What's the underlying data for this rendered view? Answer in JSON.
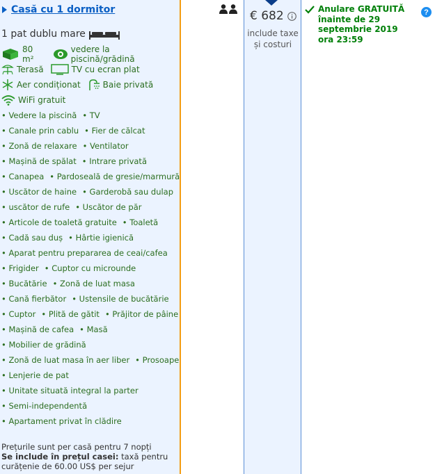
{
  "room": {
    "title": "Casă cu 1 dormitor",
    "bed": "1 pat dublu mare",
    "facilities": [
      [
        {
          "icon": "area-icon",
          "label": "80 m²"
        },
        {
          "icon": "eye-icon",
          "label": "vedere la piscină/grădină"
        }
      ],
      [
        {
          "icon": "terrace-icon",
          "label": "Terasă"
        },
        {
          "icon": "tv-icon",
          "label": "TV cu ecran plat"
        }
      ],
      [
        {
          "icon": "snowflake-icon",
          "label": "Aer condiționat"
        },
        {
          "icon": "shower-icon",
          "label": "Baie privată"
        }
      ],
      [
        {
          "icon": "wifi-icon",
          "label": "WiFi gratuit"
        }
      ]
    ],
    "amenities": [
      [
        "Vedere la piscină",
        "TV"
      ],
      [
        "Canale prin cablu",
        "Fier de călcat"
      ],
      [
        "Zonă de relaxare",
        "Ventilator"
      ],
      [
        "Mașină de spălat",
        "Intrare privată"
      ],
      [
        "Canapea",
        "Pardoseală de gresie/marmură"
      ],
      [
        "Uscător de haine",
        "Garderobă sau dulap"
      ],
      [
        "uscător de rufe",
        "Uscător de păr"
      ],
      [
        "Articole de toaletă gratuite",
        "Toaletă"
      ],
      [
        "Cadă sau duș",
        "Hârtie igienică"
      ],
      [
        "Aparat pentru prepararea de ceai/cafea"
      ],
      [
        "Frigider",
        "Cuptor cu microunde"
      ],
      [
        "Bucătărie",
        "Zonă de luat masa"
      ],
      [
        "Cană fierbător",
        "Ustensile de bucătărie"
      ],
      [
        "Cuptor",
        "Plită de gătit",
        "Prăjitor de pâine"
      ],
      [
        "Mașină de cafea",
        "Masă"
      ],
      [
        "Mobilier de grădină"
      ],
      [
        "Zonă de luat masa în aer liber",
        "Prosoape"
      ],
      [
        "Lenjerie de pat"
      ],
      [
        "Unitate situată integral la parter"
      ],
      [
        "Semi-independentă"
      ],
      [
        "Apartament privat în clădire"
      ]
    ],
    "note_line1": "Prețurile sunt per casă pentru 7 nopți",
    "note_bold": "Se include în prețul casei:",
    "note_rest": " taxă pentru curățenie de 60.00 US$ per sejur"
  },
  "price": {
    "value": "€ 682",
    "sub": "include taxe și costuri"
  },
  "conditions": {
    "text": "Anulare GRATUITĂ înainte de 29 septembrie 2019 ora 23:59",
    "help": "?"
  },
  "colors": {
    "link": "#0a5fc4",
    "green": "#008009",
    "panel": "#ebf3ff",
    "separator": "#f39c12"
  }
}
